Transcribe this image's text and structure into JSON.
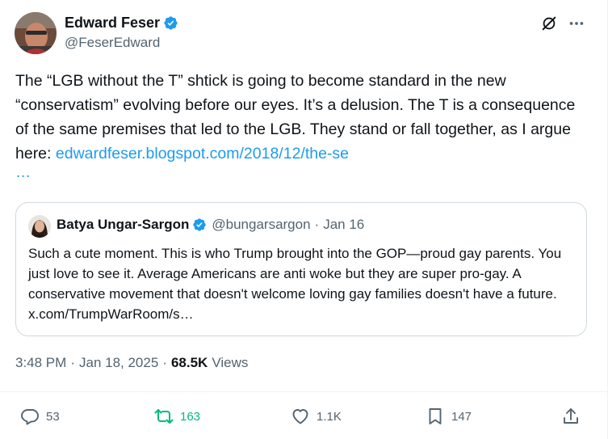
{
  "author": {
    "name": "Edward Feser",
    "handle": "@FeserEdward"
  },
  "tweet": {
    "text": "The “LGB without the T” shtick is going to become standard in the new “conservatism” evolving before our eyes. It’s a delusion. The T is a consequence of the same premises that led to the LGB. They stand or fall together, as I argue here: ",
    "link": "edwardfeser.blogspot.com/2018/12/the-se",
    "link_ellipsis": "…"
  },
  "quote": {
    "name": "Batya Ungar-Sargon",
    "handle": "@bungarsargon",
    "separator": "·",
    "date": "Jan 16",
    "text": "Such a cute moment. This is who Trump brought into the GOP—proud gay parents. You just love to see it. Average Americans are anti woke but they are super pro-gay. A conservative movement that doesn't welcome loving gay families doesn't have a future. x.com/TrumpWarRoom/s…"
  },
  "meta": {
    "time": "3:48 PM",
    "separator": "·",
    "date": "Jan 18, 2025",
    "views_count": "68.5K",
    "views_label": "Views"
  },
  "actions": {
    "replies": "53",
    "reposts": "163",
    "likes": "1.1K",
    "bookmarks": "147"
  },
  "icons": {
    "verified": "verified-badge-icon",
    "grok": "grok-icon",
    "more": "more-dots-icon",
    "reply": "reply-bubble-icon",
    "repost": "repost-arrows-icon",
    "like": "heart-icon",
    "bookmark": "bookmark-icon",
    "share": "share-upload-icon"
  },
  "colors": {
    "link": "#1d9bf0",
    "verified": "#1d9bf0",
    "repost_active": "#00ba7c",
    "secondary_text": "#536471",
    "primary_text": "#0f1419"
  }
}
